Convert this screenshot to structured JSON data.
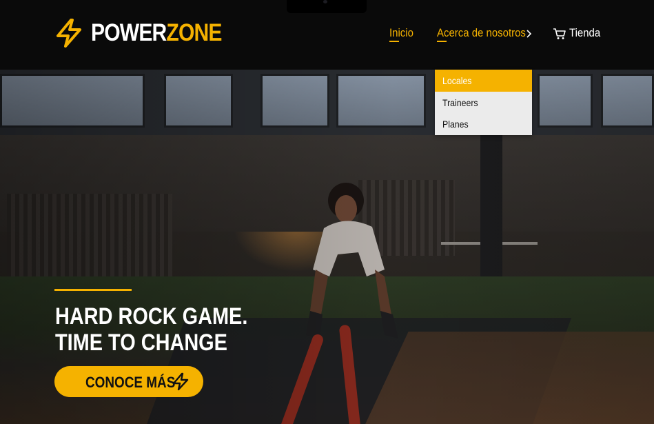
{
  "brand": {
    "part1": "POWER",
    "part2": "ZONE"
  },
  "nav": {
    "inicio": "Inicio",
    "acerca": "Acerca de nosotros",
    "tienda": "Tienda"
  },
  "dropdown": {
    "items": [
      "Locales",
      "Traineers",
      "Planes"
    ],
    "active_index": 0
  },
  "hero": {
    "line1": "HARD ROCK GAME.",
    "line2": "TIME TO CHANGE",
    "cta": "CONOCE MÁS"
  },
  "colors": {
    "accent": "#f5b200",
    "header_bg": "#0a0a0a",
    "dropdown_bg": "#ebebeb"
  },
  "icons": {
    "logo": "lightning-bolt-icon",
    "chevron": "chevron-right-icon",
    "cart": "shopping-cart-icon",
    "cta": "lightning-bolt-icon"
  }
}
